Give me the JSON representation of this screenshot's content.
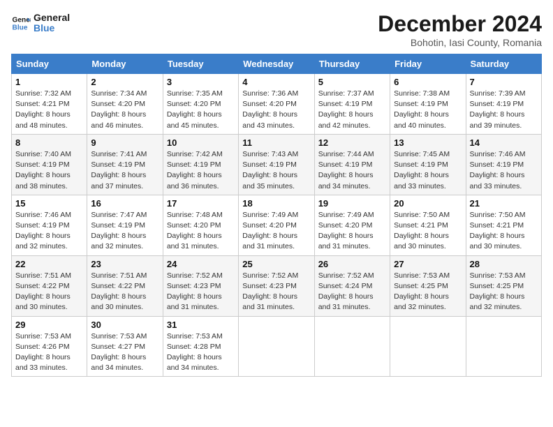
{
  "logo": {
    "line1": "General",
    "line2": "Blue"
  },
  "title": "December 2024",
  "location": "Bohotin, Iasi County, Romania",
  "weekdays": [
    "Sunday",
    "Monday",
    "Tuesday",
    "Wednesday",
    "Thursday",
    "Friday",
    "Saturday"
  ],
  "weeks": [
    [
      {
        "day": "1",
        "info": "Sunrise: 7:32 AM\nSunset: 4:21 PM\nDaylight: 8 hours\nand 48 minutes."
      },
      {
        "day": "2",
        "info": "Sunrise: 7:34 AM\nSunset: 4:20 PM\nDaylight: 8 hours\nand 46 minutes."
      },
      {
        "day": "3",
        "info": "Sunrise: 7:35 AM\nSunset: 4:20 PM\nDaylight: 8 hours\nand 45 minutes."
      },
      {
        "day": "4",
        "info": "Sunrise: 7:36 AM\nSunset: 4:20 PM\nDaylight: 8 hours\nand 43 minutes."
      },
      {
        "day": "5",
        "info": "Sunrise: 7:37 AM\nSunset: 4:19 PM\nDaylight: 8 hours\nand 42 minutes."
      },
      {
        "day": "6",
        "info": "Sunrise: 7:38 AM\nSunset: 4:19 PM\nDaylight: 8 hours\nand 40 minutes."
      },
      {
        "day": "7",
        "info": "Sunrise: 7:39 AM\nSunset: 4:19 PM\nDaylight: 8 hours\nand 39 minutes."
      }
    ],
    [
      {
        "day": "8",
        "info": "Sunrise: 7:40 AM\nSunset: 4:19 PM\nDaylight: 8 hours\nand 38 minutes."
      },
      {
        "day": "9",
        "info": "Sunrise: 7:41 AM\nSunset: 4:19 PM\nDaylight: 8 hours\nand 37 minutes."
      },
      {
        "day": "10",
        "info": "Sunrise: 7:42 AM\nSunset: 4:19 PM\nDaylight: 8 hours\nand 36 minutes."
      },
      {
        "day": "11",
        "info": "Sunrise: 7:43 AM\nSunset: 4:19 PM\nDaylight: 8 hours\nand 35 minutes."
      },
      {
        "day": "12",
        "info": "Sunrise: 7:44 AM\nSunset: 4:19 PM\nDaylight: 8 hours\nand 34 minutes."
      },
      {
        "day": "13",
        "info": "Sunrise: 7:45 AM\nSunset: 4:19 PM\nDaylight: 8 hours\nand 33 minutes."
      },
      {
        "day": "14",
        "info": "Sunrise: 7:46 AM\nSunset: 4:19 PM\nDaylight: 8 hours\nand 33 minutes."
      }
    ],
    [
      {
        "day": "15",
        "info": "Sunrise: 7:46 AM\nSunset: 4:19 PM\nDaylight: 8 hours\nand 32 minutes."
      },
      {
        "day": "16",
        "info": "Sunrise: 7:47 AM\nSunset: 4:19 PM\nDaylight: 8 hours\nand 32 minutes."
      },
      {
        "day": "17",
        "info": "Sunrise: 7:48 AM\nSunset: 4:20 PM\nDaylight: 8 hours\nand 31 minutes."
      },
      {
        "day": "18",
        "info": "Sunrise: 7:49 AM\nSunset: 4:20 PM\nDaylight: 8 hours\nand 31 minutes."
      },
      {
        "day": "19",
        "info": "Sunrise: 7:49 AM\nSunset: 4:20 PM\nDaylight: 8 hours\nand 31 minutes."
      },
      {
        "day": "20",
        "info": "Sunrise: 7:50 AM\nSunset: 4:21 PM\nDaylight: 8 hours\nand 30 minutes."
      },
      {
        "day": "21",
        "info": "Sunrise: 7:50 AM\nSunset: 4:21 PM\nDaylight: 8 hours\nand 30 minutes."
      }
    ],
    [
      {
        "day": "22",
        "info": "Sunrise: 7:51 AM\nSunset: 4:22 PM\nDaylight: 8 hours\nand 30 minutes."
      },
      {
        "day": "23",
        "info": "Sunrise: 7:51 AM\nSunset: 4:22 PM\nDaylight: 8 hours\nand 30 minutes."
      },
      {
        "day": "24",
        "info": "Sunrise: 7:52 AM\nSunset: 4:23 PM\nDaylight: 8 hours\nand 31 minutes."
      },
      {
        "day": "25",
        "info": "Sunrise: 7:52 AM\nSunset: 4:23 PM\nDaylight: 8 hours\nand 31 minutes."
      },
      {
        "day": "26",
        "info": "Sunrise: 7:52 AM\nSunset: 4:24 PM\nDaylight: 8 hours\nand 31 minutes."
      },
      {
        "day": "27",
        "info": "Sunrise: 7:53 AM\nSunset: 4:25 PM\nDaylight: 8 hours\nand 32 minutes."
      },
      {
        "day": "28",
        "info": "Sunrise: 7:53 AM\nSunset: 4:25 PM\nDaylight: 8 hours\nand 32 minutes."
      }
    ],
    [
      {
        "day": "29",
        "info": "Sunrise: 7:53 AM\nSunset: 4:26 PM\nDaylight: 8 hours\nand 33 minutes."
      },
      {
        "day": "30",
        "info": "Sunrise: 7:53 AM\nSunset: 4:27 PM\nDaylight: 8 hours\nand 34 minutes."
      },
      {
        "day": "31",
        "info": "Sunrise: 7:53 AM\nSunset: 4:28 PM\nDaylight: 8 hours\nand 34 minutes."
      },
      null,
      null,
      null,
      null
    ]
  ]
}
